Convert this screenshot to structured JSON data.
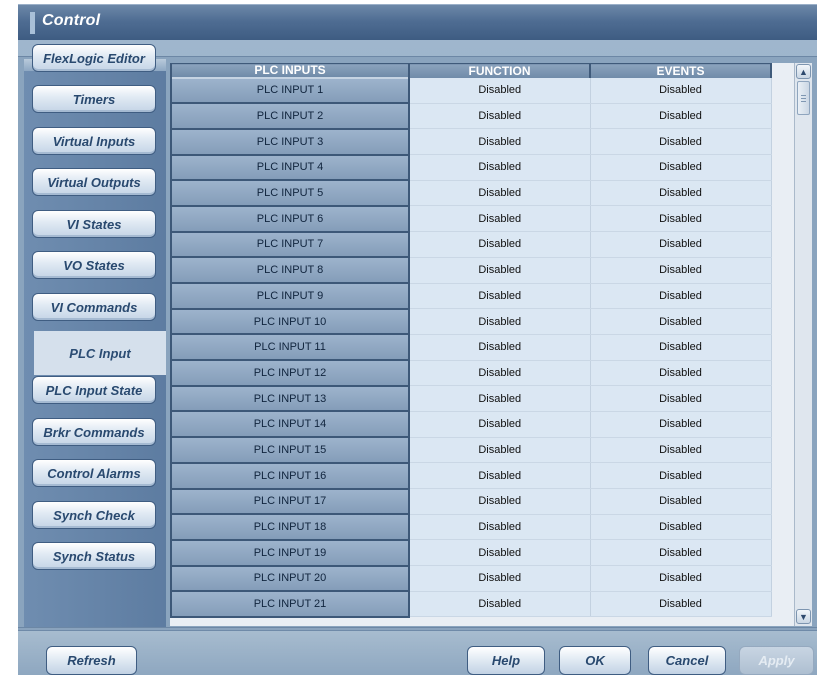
{
  "window": {
    "title": "Control"
  },
  "sidebar": {
    "items": [
      {
        "label": "FlexLogic Editor",
        "active": false
      },
      {
        "label": "Timers",
        "active": false
      },
      {
        "label": "Virtual Inputs",
        "active": false
      },
      {
        "label": "Virtual Outputs",
        "active": false
      },
      {
        "label": "VI States",
        "active": false
      },
      {
        "label": "VO States",
        "active": false
      },
      {
        "label": "VI Commands",
        "active": false
      },
      {
        "label": "PLC Input",
        "active": true
      },
      {
        "label": "PLC Input State",
        "active": false
      },
      {
        "label": "Brkr Commands",
        "active": false
      },
      {
        "label": "Control Alarms",
        "active": false
      },
      {
        "label": "Synch Check",
        "active": false
      },
      {
        "label": "Synch Status",
        "active": false
      }
    ]
  },
  "table": {
    "headers": [
      "PLC INPUTS",
      "FUNCTION",
      "EVENTS"
    ],
    "rows": [
      [
        "PLC INPUT 1",
        "Disabled",
        "Disabled"
      ],
      [
        "PLC INPUT 2",
        "Disabled",
        "Disabled"
      ],
      [
        "PLC INPUT 3",
        "Disabled",
        "Disabled"
      ],
      [
        "PLC INPUT 4",
        "Disabled",
        "Disabled"
      ],
      [
        "PLC INPUT 5",
        "Disabled",
        "Disabled"
      ],
      [
        "PLC INPUT 6",
        "Disabled",
        "Disabled"
      ],
      [
        "PLC INPUT 7",
        "Disabled",
        "Disabled"
      ],
      [
        "PLC INPUT 8",
        "Disabled",
        "Disabled"
      ],
      [
        "PLC INPUT 9",
        "Disabled",
        "Disabled"
      ],
      [
        "PLC INPUT 10",
        "Disabled",
        "Disabled"
      ],
      [
        "PLC INPUT 11",
        "Disabled",
        "Disabled"
      ],
      [
        "PLC INPUT 12",
        "Disabled",
        "Disabled"
      ],
      [
        "PLC INPUT 13",
        "Disabled",
        "Disabled"
      ],
      [
        "PLC INPUT 14",
        "Disabled",
        "Disabled"
      ],
      [
        "PLC INPUT 15",
        "Disabled",
        "Disabled"
      ],
      [
        "PLC INPUT 16",
        "Disabled",
        "Disabled"
      ],
      [
        "PLC INPUT 17",
        "Disabled",
        "Disabled"
      ],
      [
        "PLC INPUT 18",
        "Disabled",
        "Disabled"
      ],
      [
        "PLC INPUT 19",
        "Disabled",
        "Disabled"
      ],
      [
        "PLC INPUT 20",
        "Disabled",
        "Disabled"
      ],
      [
        "PLC INPUT 21",
        "Disabled",
        "Disabled"
      ]
    ]
  },
  "scrollbar": {
    "up_icon": "chevron-up-icon",
    "down_icon": "chevron-down-icon"
  },
  "footer": {
    "refresh_label": "Refresh",
    "help_label": "Help",
    "ok_label": "OK",
    "cancel_label": "Cancel",
    "apply_label": "Apply",
    "apply_enabled": false
  },
  "colors": {
    "accent": "#4f6d93",
    "panel": "#8aa4be",
    "cell": "#dbe7f3",
    "text_nav": "#29496f"
  }
}
